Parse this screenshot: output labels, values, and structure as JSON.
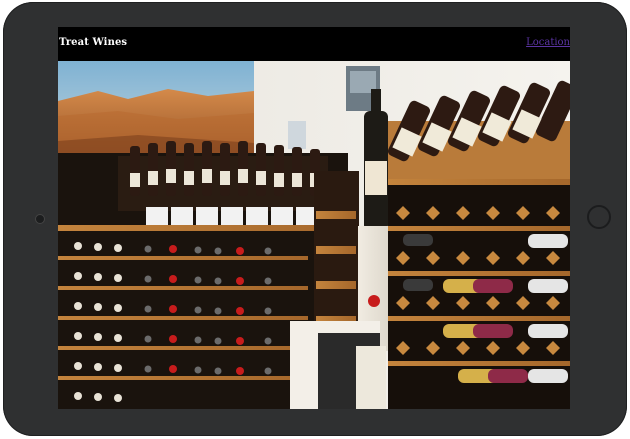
{
  "site": {
    "brand": "Treat Wines",
    "nav_link": "Location"
  },
  "colors": {
    "device_frame": "#2f3031",
    "screen_bg": "#000000",
    "brand_text": "#ffffff",
    "link": "#5b34a3"
  },
  "hero": {
    "alt": "Wine shop interior with wooden wine racks full of bottles"
  }
}
